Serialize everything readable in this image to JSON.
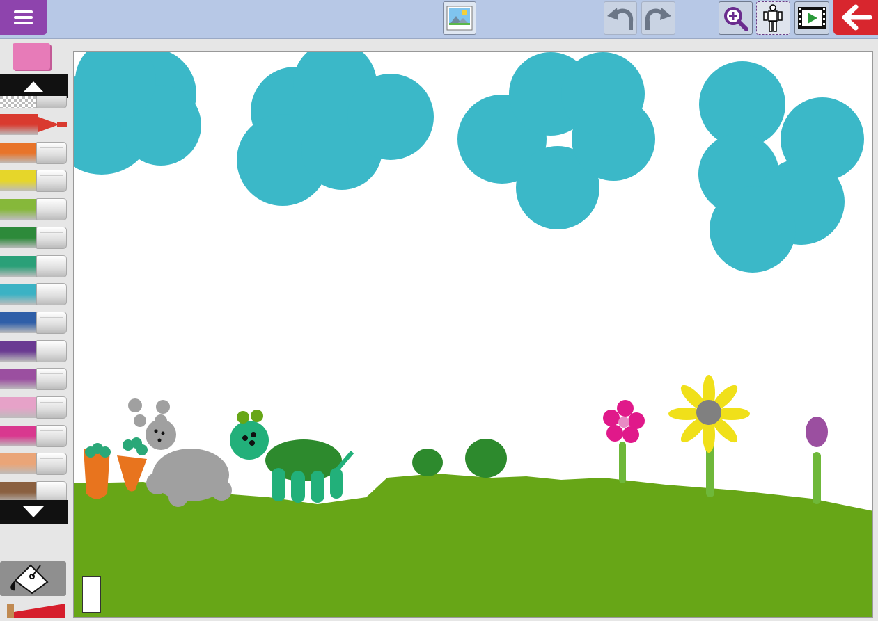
{
  "toolbar": {
    "menu_icon": "hamburger-menu-icon",
    "image_icon": "image-picture-icon",
    "undo_icon": "undo-arrow-icon",
    "redo_icon": "redo-arrow-icon",
    "zoom_icon": "zoom-in-magnifier-icon",
    "figure_icon": "figure-stamp-icon",
    "play_icon": "film-play-icon",
    "back_icon": "back-arrow-icon"
  },
  "palette": {
    "colors": [
      "#d93a2f",
      "#e8742a",
      "#e6d62a",
      "#86b83a",
      "#2d8a3a",
      "#2aa078",
      "#3bb2c4",
      "#2f5fa8",
      "#6a3a92",
      "#9b4fa0",
      "#e6a2c8",
      "#d9388f",
      "#eaa578",
      "#8a6040"
    ],
    "selected_index": 0
  },
  "colors": {
    "topbar": "#b7c8e6",
    "menu": "#8e44ad",
    "back": "#d8262e",
    "sky_clouds": "#3bb8c8",
    "grass": "#67a617"
  }
}
